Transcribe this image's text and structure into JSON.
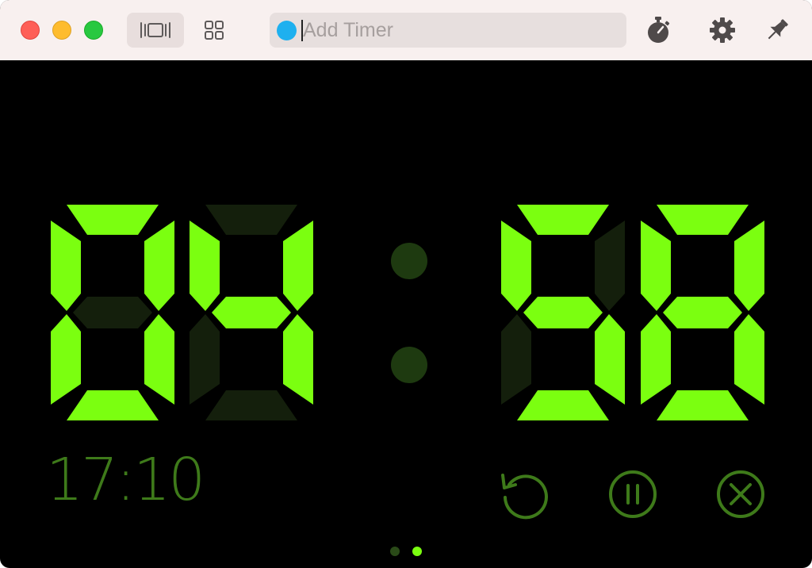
{
  "toolbar": {
    "search_placeholder": "Add Timer",
    "search_value": "",
    "view_modes": [
      "single-timer-view",
      "grid-view"
    ],
    "icons": [
      "stopwatch-icon",
      "gear-icon",
      "pin-icon"
    ]
  },
  "timer": {
    "digits": [
      "0",
      "4",
      "5",
      "8"
    ],
    "clock_time": "17:10",
    "controls": [
      "reset",
      "pause",
      "cancel"
    ]
  },
  "pager": {
    "page_count": 2,
    "current_page": 2
  },
  "colors": {
    "segment_on": "#7bff10",
    "segment_off": "#141f0c",
    "colon": "#1e3a10",
    "accent_dim": "#3e7a1a",
    "search_dot": "#1eb0ef",
    "titlebar": "#f8f0ef"
  }
}
